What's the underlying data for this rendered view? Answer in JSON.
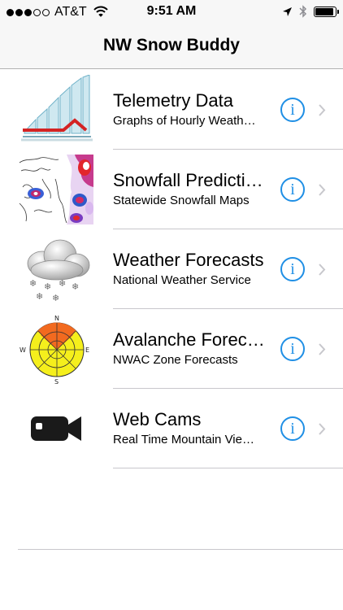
{
  "status_bar": {
    "carrier": "AT&T",
    "time": "9:51 AM",
    "signal_bars_filled": 3,
    "signal_bars_total": 5,
    "battery_level": 0.9
  },
  "nav": {
    "title": "NW Snow Buddy"
  },
  "colors": {
    "accent": "#1f8fe5",
    "separator": "#c8c7cc",
    "bar_bg": "#f7f7f7"
  },
  "items": [
    {
      "title": "Telemetry Data",
      "subtitle": "Graphs of Hourly Weath…",
      "icon": "telemetry-chart-icon"
    },
    {
      "title": "Snowfall Predicti…",
      "subtitle": "Statewide Snowfall Maps",
      "icon": "snowfall-map-icon"
    },
    {
      "title": "Weather Forecasts",
      "subtitle": "National Weather Service",
      "icon": "snow-cloud-icon"
    },
    {
      "title": "Avalanche Forec…",
      "subtitle": "NWAC Zone Forecasts",
      "icon": "avalanche-rose-icon",
      "compass": {
        "n": "N",
        "e": "E",
        "s": "S",
        "w": "W"
      }
    },
    {
      "title": "Web Cams",
      "subtitle": "Real Time Mountain Vie…",
      "icon": "video-camera-icon"
    }
  ]
}
